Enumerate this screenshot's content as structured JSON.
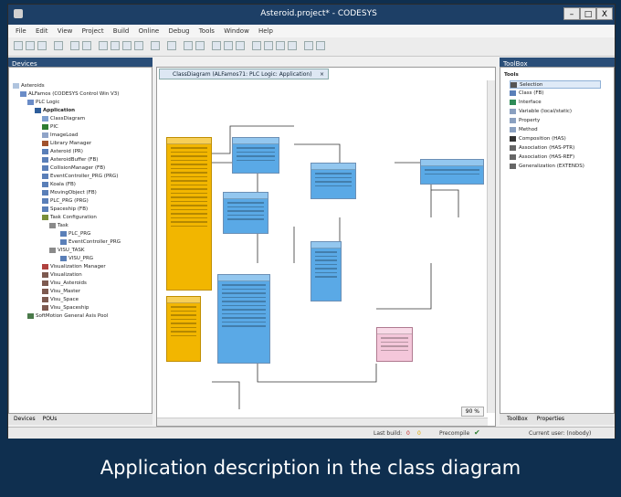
{
  "window": {
    "title": "Asteroid.project* - CODESYS",
    "controls": [
      "–",
      "□",
      "X"
    ]
  },
  "menu": [
    "File",
    "Edit",
    "View",
    "Project",
    "Build",
    "Online",
    "Debug",
    "Tools",
    "Window",
    "Help"
  ],
  "devices_pane": {
    "title": "Devices",
    "tree": [
      "Asteroids",
      "ALFamos (CODESYS Control Win V3)",
      "PLC Logic",
      "Application",
      "ClassDiagram",
      "PIC",
      "ImageLoad",
      "Library Manager",
      "Asteroid (PR)",
      "AsteroidBuffer (FB)",
      "CollisionManager (FB)",
      "EventController_PRG (PRG)",
      "Koala (FB)",
      "MovingObject (FB)",
      "PLC_PRG (PRG)",
      "Spaceship (FB)",
      "Task Configuration",
      "Task",
      "PLC_PRG",
      "EventController_PRG",
      "VISU_TASK",
      "VISU_PRG",
      "Visualization Manager",
      "Visualization",
      "Visu_Asteroids",
      "Visu_Master",
      "Visu_Space",
      "Visu_Spaceship",
      "SoftMotion General Axis Pool"
    ],
    "bottom_tabs": [
      "Devices",
      "POUs"
    ]
  },
  "editor": {
    "tab_label": "ClassDiagram (ALFamos71: PLC Logic: Application)",
    "zoom": "90 %"
  },
  "toolbox": {
    "title": "ToolBox",
    "section": "Tools",
    "items": [
      "Selection",
      "Class (FB)",
      "Interface",
      "Variable (local/static)",
      "Property",
      "Method",
      "Composition (HAS)",
      "Association (HAS-PTR)",
      "Association (HAS-REF)",
      "Generalization (EXTENDS)"
    ],
    "bottom_tabs": [
      "ToolBox",
      "Properties"
    ]
  },
  "status": {
    "lastbuild": "Last build:",
    "errors": "0",
    "warnings": "0",
    "precompile": "Precompile",
    "user": "Current user: (nobody)"
  },
  "caption": "Application description in the class diagram"
}
